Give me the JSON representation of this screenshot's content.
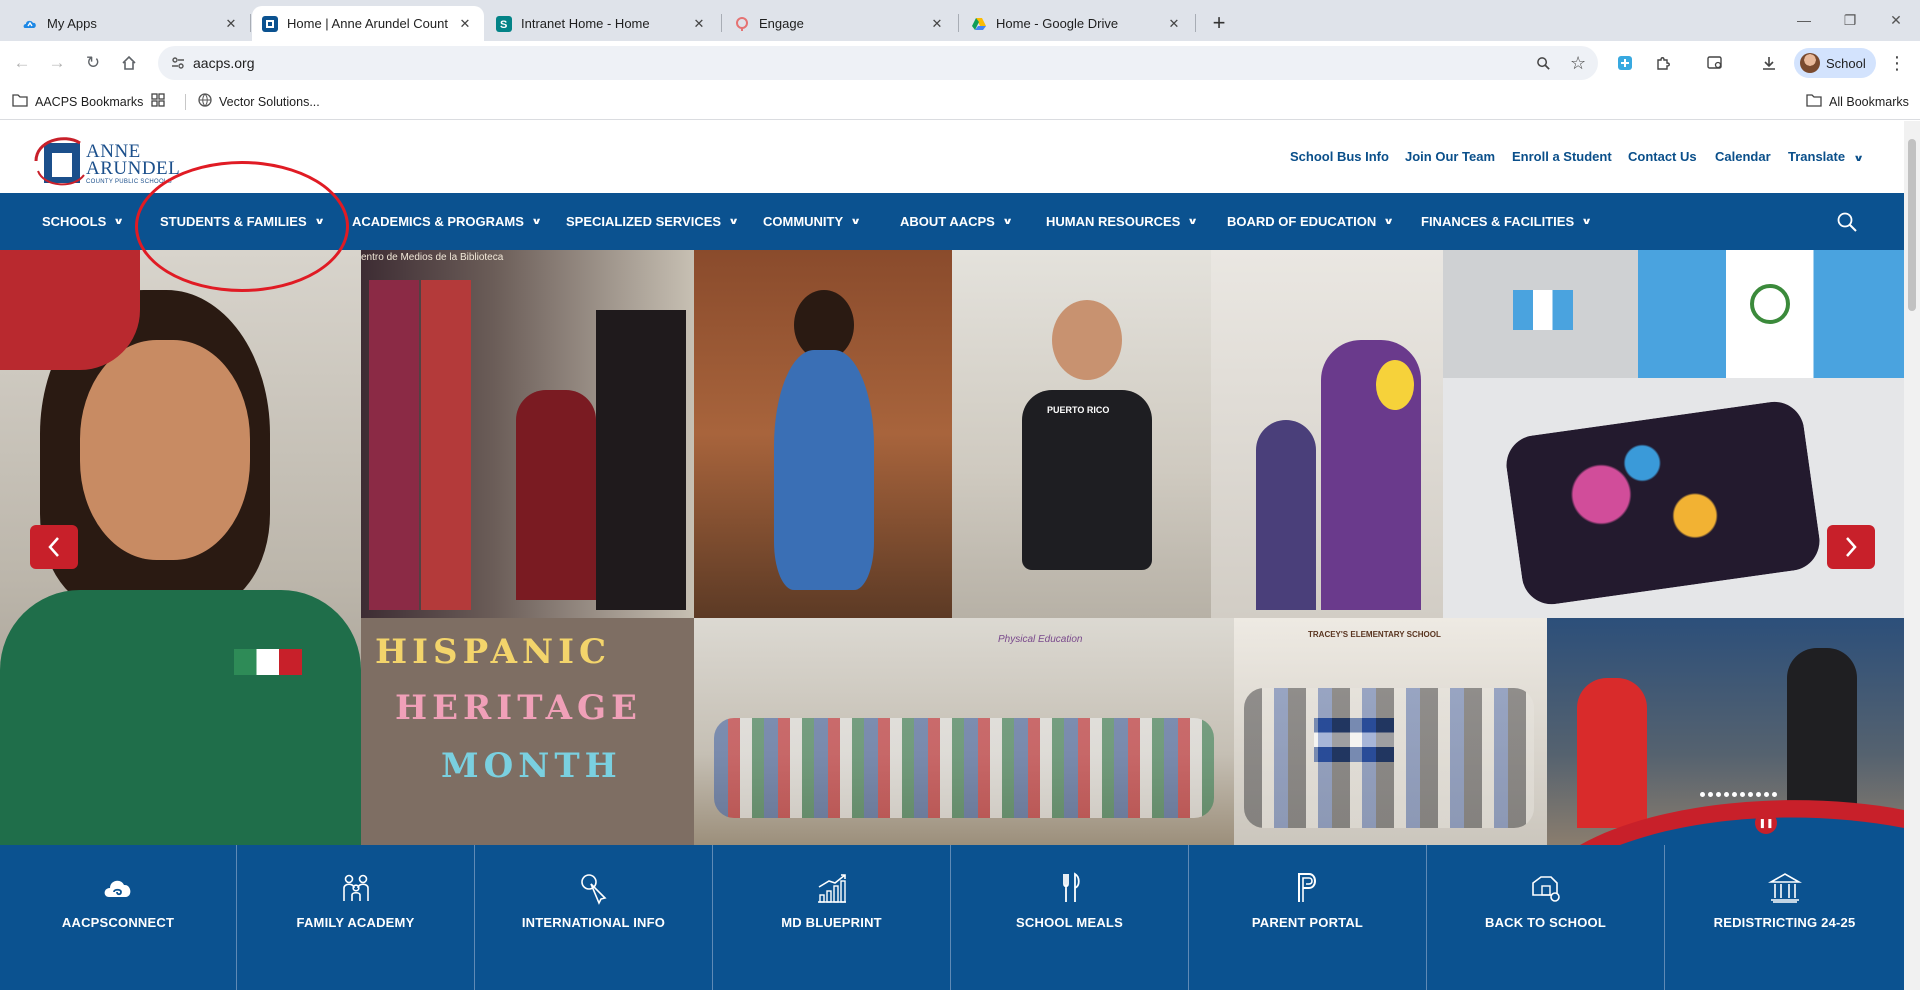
{
  "browser": {
    "tabs": [
      {
        "title": "My Apps",
        "icon": "my-apps-icon",
        "active": false
      },
      {
        "title": "Home | Anne Arundel County P",
        "icon": "aacps-icon",
        "active": true
      },
      {
        "title": "Intranet Home - Home",
        "icon": "sharepoint-icon",
        "active": false
      },
      {
        "title": "Engage",
        "icon": "engage-icon",
        "active": false
      },
      {
        "title": "Home - Google Drive",
        "icon": "google-drive-icon",
        "active": false
      }
    ],
    "url": "aacps.org",
    "profile_label": "School",
    "bookmarks": {
      "folder": "AACPS Bookmarks",
      "vector": "Vector Solutions...",
      "all": "All Bookmarks"
    }
  },
  "site": {
    "logo": {
      "line1": "ANNE",
      "line2": "ARUNDEL",
      "line3": "COUNTY PUBLIC SCHOOLS"
    },
    "utility_links": [
      "School Bus Info",
      "Join Our Team",
      "Enroll a Student",
      "Contact Us",
      "Calendar"
    ],
    "translate_label": "Translate",
    "nav": [
      "SCHOOLS",
      "STUDENTS & FAMILIES",
      "ACADEMICS & PROGRAMS",
      "SPECIALIZED SERVICES",
      "COMMUNITY",
      "ABOUT AACPS",
      "HUMAN RESOURCES",
      "BOARD OF EDUCATION",
      "FINANCES & FACILITIES"
    ],
    "hero": {
      "library_sign": "entro de Medios de la Biblioteca",
      "banner_words": [
        "HISPANIC",
        "HERITAGE",
        "MONTH"
      ],
      "shirt_text": "PUERTO RICO",
      "school_banner": "TRACEY'S ELEMENTARY SCHOOL",
      "gym_sign": "Physical Education"
    },
    "quick_links": [
      {
        "label": "AACPSCONNECT",
        "icon": "cloud-icon"
      },
      {
        "label": "FAMILY ACADEMY",
        "icon": "family-icon"
      },
      {
        "label": "INTERNATIONAL INFO",
        "icon": "pointer-icon"
      },
      {
        "label": "MD BLUEPRINT",
        "icon": "growth-chart-icon"
      },
      {
        "label": "SCHOOL MEALS",
        "icon": "fork-knife-icon"
      },
      {
        "label": "PARENT PORTAL",
        "icon": "parent-portal-icon"
      },
      {
        "label": "BACK TO SCHOOL",
        "icon": "school-bus-icon"
      },
      {
        "label": "REDISTRICTING 24-25",
        "icon": "building-icon"
      }
    ]
  },
  "colors": {
    "nav_blue": "#0b5290",
    "accent_red": "#c8202a",
    "annotation_red": "#e01b24"
  }
}
